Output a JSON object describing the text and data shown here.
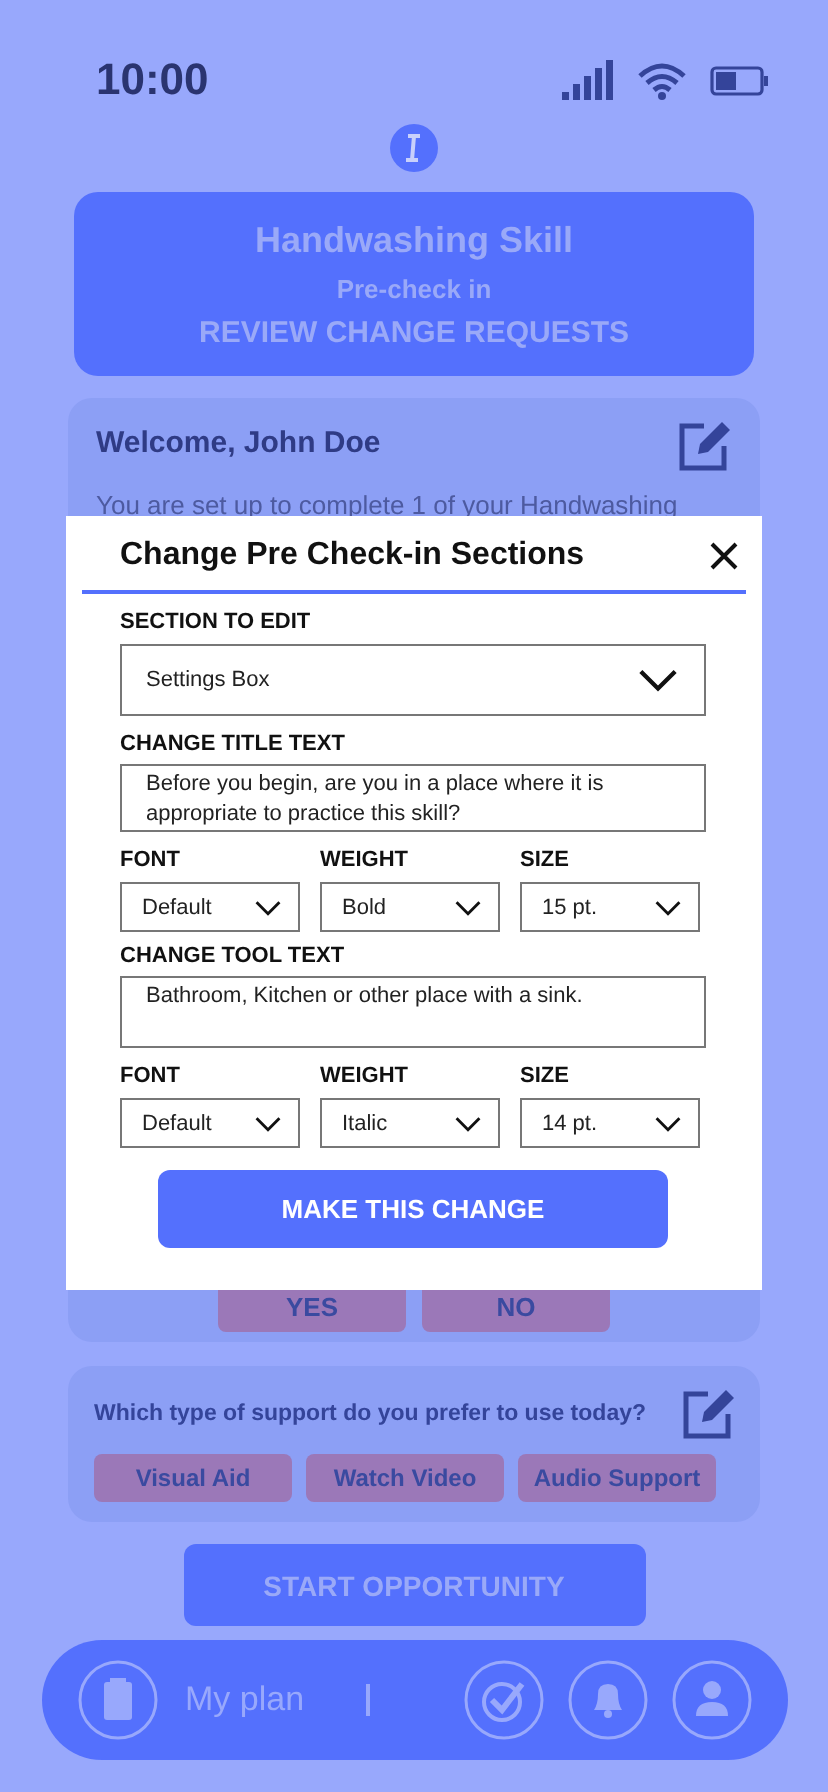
{
  "status_bar": {
    "time": "10:00"
  },
  "header": {
    "title": "Handwashing Skill",
    "subtitle": "Pre-check in",
    "action": "REVIEW CHANGE REQUESTS"
  },
  "welcome": {
    "title": "Welcome, John Doe",
    "text": "You are set up to complete 1 of your Handwashing",
    "buttons": [
      "YES",
      "NO"
    ]
  },
  "support": {
    "question": "Which type of support do you prefer to use today?",
    "options": [
      "Visual Aid",
      "Watch Video",
      "Audio Support"
    ]
  },
  "start_button": "START OPPORTUNITY",
  "nav": {
    "label": "My plan"
  },
  "modal": {
    "title": "Change Pre Check-in Sections",
    "section": {
      "label": "SECTION TO EDIT",
      "value": "Settings Box"
    },
    "groups": [
      {
        "label": "CHANGE TITLE TEXT",
        "text": "Before you begin, are you in a place where it is appropriate to practice this skill?",
        "fields": [
          {
            "label": "FONT",
            "value": "Default"
          },
          {
            "label": "WEIGHT",
            "value": "Bold"
          },
          {
            "label": "SIZE",
            "value": "15 pt."
          }
        ]
      },
      {
        "label": "CHANGE TOOL TEXT",
        "text": "Bathroom, Kitchen or other place with a sink.",
        "fields": [
          {
            "label": "FONT",
            "value": "Default"
          },
          {
            "label": "WEIGHT",
            "value": "Italic"
          },
          {
            "label": "SIZE",
            "value": "14 pt."
          }
        ]
      }
    ],
    "submit": "MAKE THIS CHANGE"
  }
}
